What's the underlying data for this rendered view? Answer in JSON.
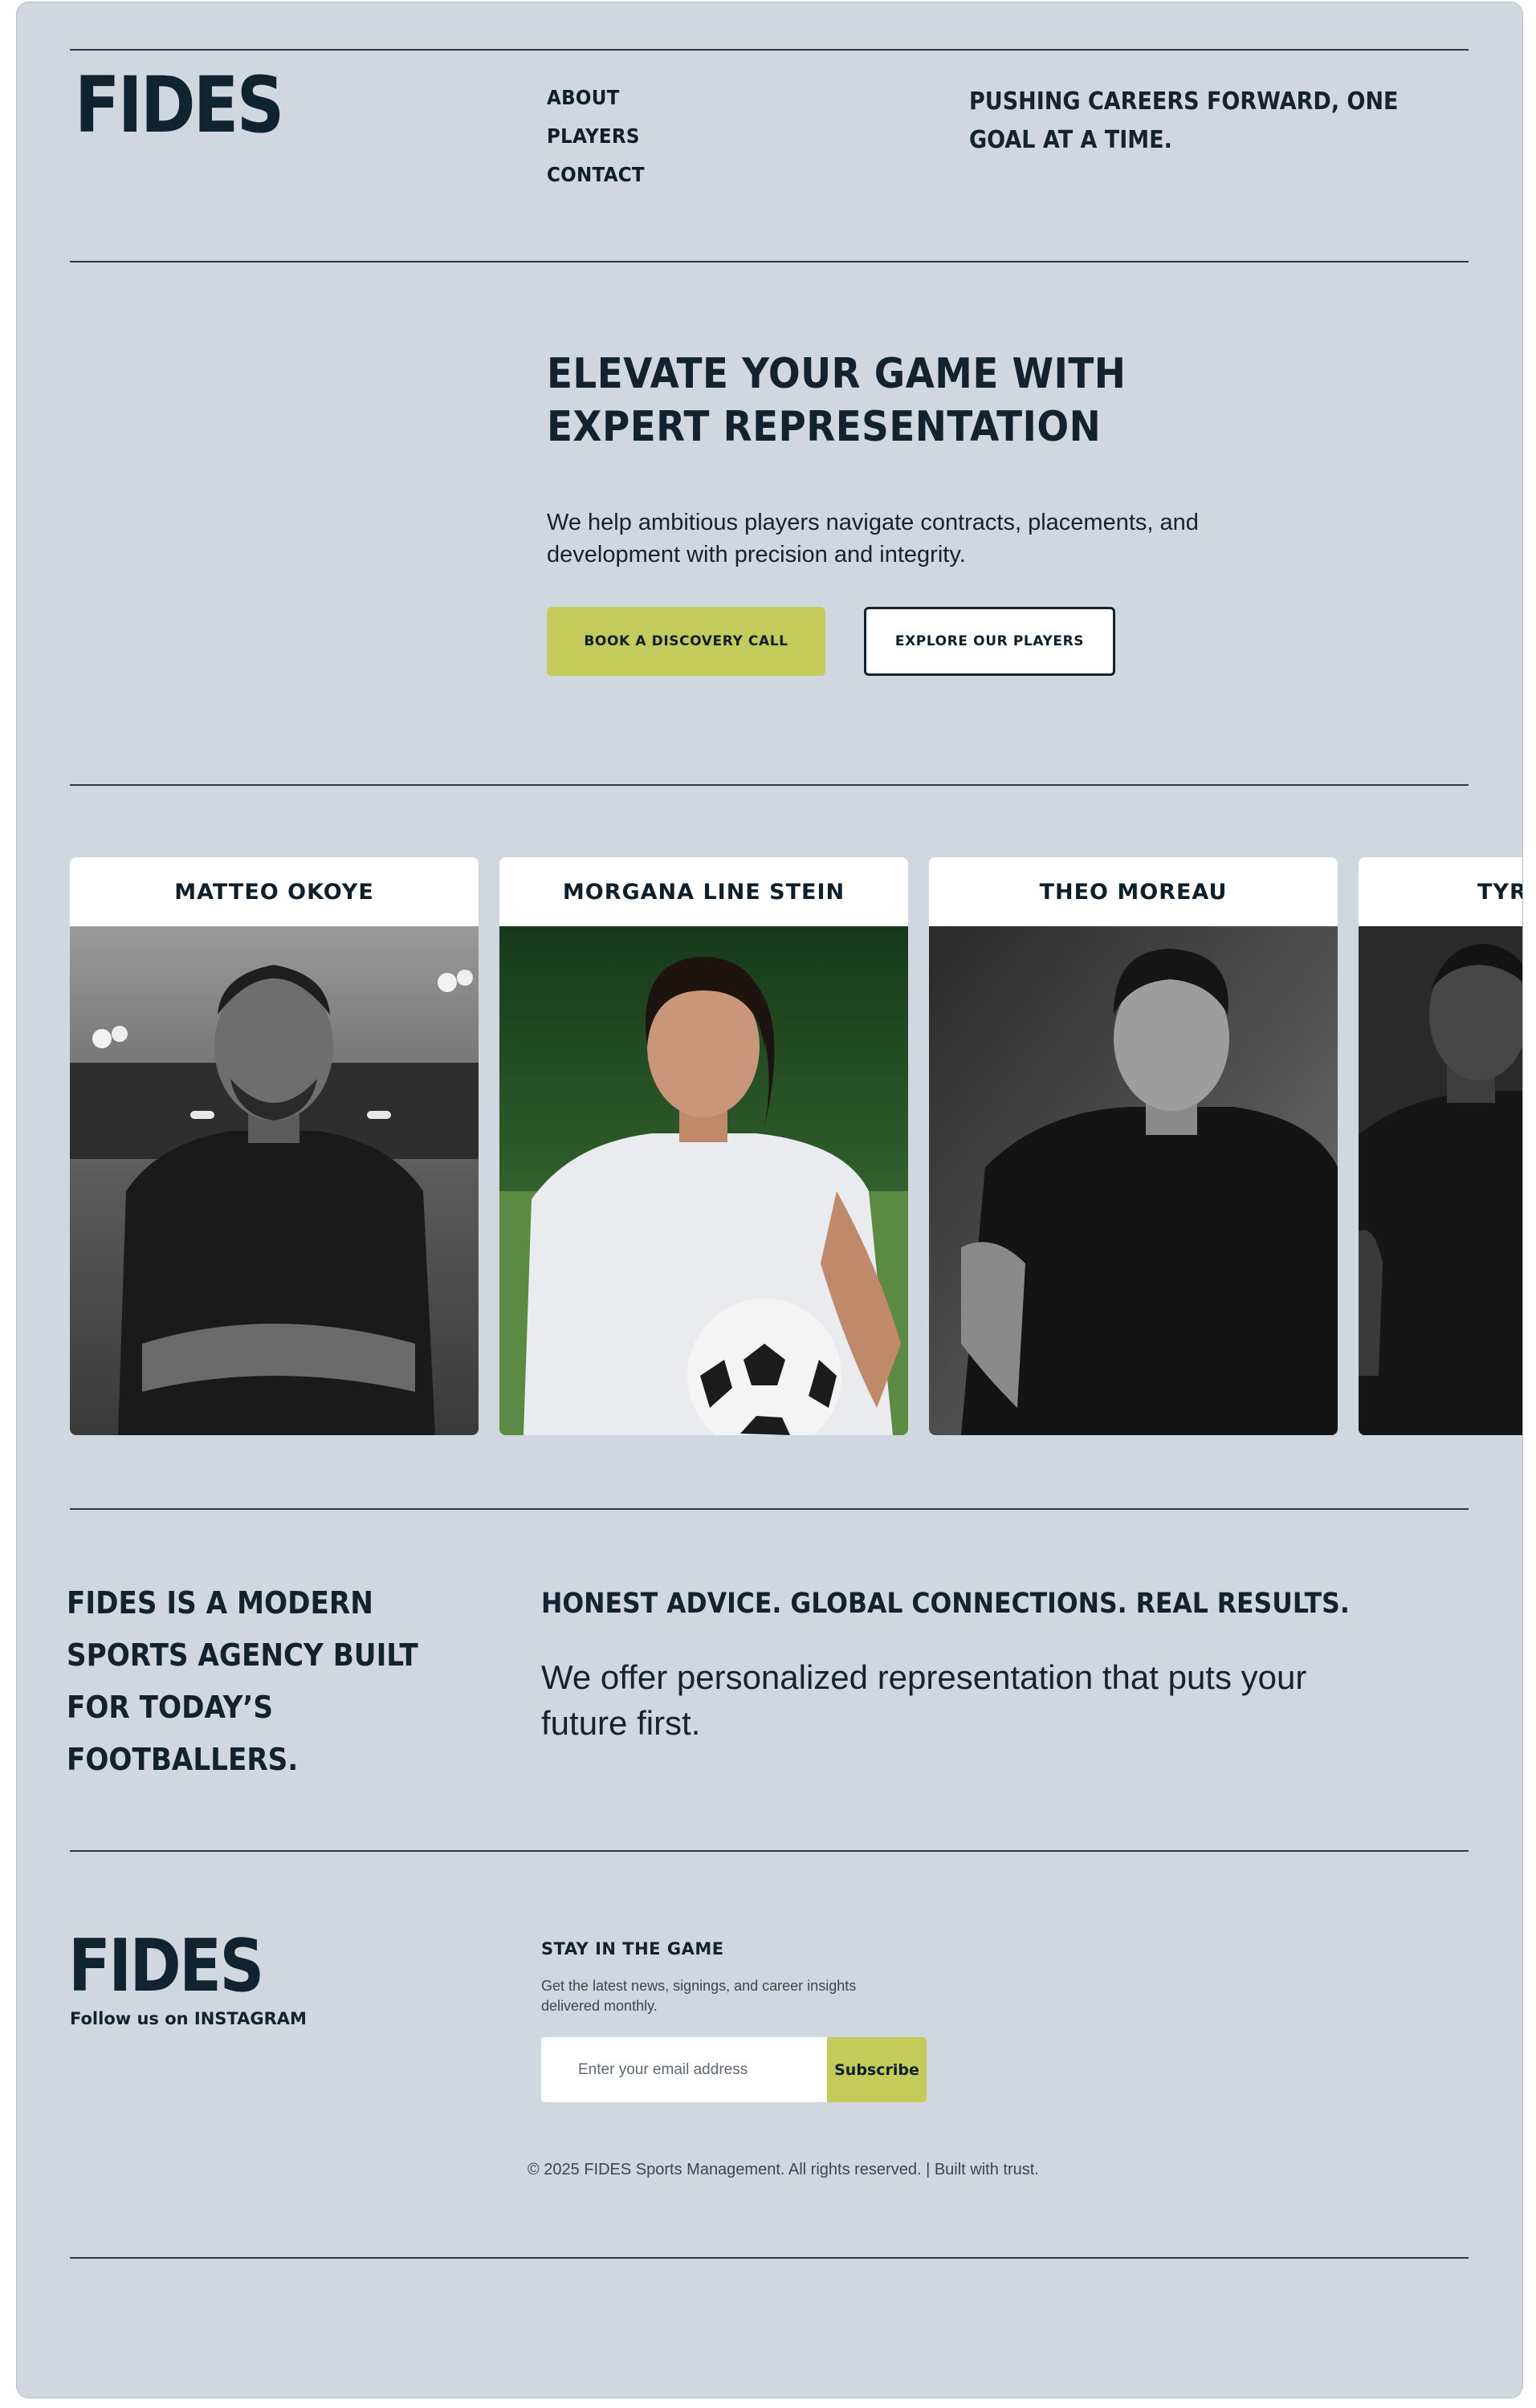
{
  "brand": {
    "logo": "FIDES"
  },
  "nav": {
    "items": [
      "ABOUT",
      "PLAYERS",
      "CONTACT"
    ]
  },
  "header": {
    "tagline": "PUSHING CAREERS FORWARD, ONE GOAL AT A TIME."
  },
  "hero": {
    "title_line1": "ELEVATE YOUR GAME WITH",
    "title_line2": "EXPERT REPRESENTATION",
    "subtitle": "We help ambitious players navigate contracts, placements, and development with precision and integrity.",
    "primary_cta": "BOOK A DISCOVERY CALL",
    "secondary_cta": "EXPLORE OUR PLAYERS"
  },
  "players": [
    {
      "name": "MATTEO OKOYE"
    },
    {
      "name": "MORGANA LINE STEIN"
    },
    {
      "name": "THEO MOREAU"
    },
    {
      "name": "TYRE"
    }
  ],
  "about": {
    "statement": "FIDES IS A MODERN SPORTS AGENCY BUILT FOR TODAY’S FOOTBALLERS.",
    "headline": "HONEST ADVICE. GLOBAL CONNECTIONS. REAL RESULTS.",
    "body": "We offer personalized representation that puts your future first."
  },
  "footer": {
    "logo": "FIDES",
    "follow_prefix": "Follow us on",
    "follow_network": "INSTAGRAM",
    "newsletter_title": "STAY IN THE GAME",
    "newsletter_desc": "Get the latest news, signings, and career insights delivered monthly.",
    "email_placeholder": "Enter your email address",
    "subscribe_label": "Subscribe",
    "copyright": "© 2025 FIDES Sports Management. All rights reserved. | Built with trust."
  },
  "colors": {
    "background": "#d1d7df",
    "ink": "#12232f",
    "accent": "#c3cb5b"
  }
}
